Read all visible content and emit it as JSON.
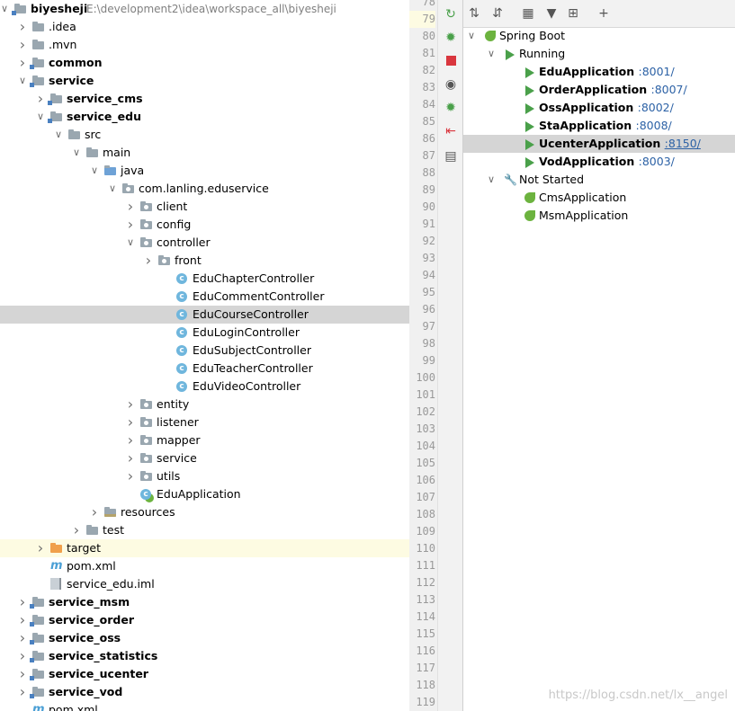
{
  "project": {
    "root_name": "biyesheji",
    "root_path": "E:\\development2\\idea\\workspace_all\\biyesheji",
    "items": [
      {
        "label": "biyesheji",
        "depth": 0,
        "arrow": "down",
        "icon": "folder-mod",
        "bold": true
      },
      {
        "label": ".idea",
        "depth": 1,
        "arrow": "right",
        "icon": "folder"
      },
      {
        "label": ".mvn",
        "depth": 1,
        "arrow": "right",
        "icon": "folder"
      },
      {
        "label": "common",
        "depth": 1,
        "arrow": "right",
        "icon": "folder-mod",
        "bold": true
      },
      {
        "label": "service",
        "depth": 1,
        "arrow": "down",
        "icon": "folder-mod",
        "bold": true
      },
      {
        "label": "service_cms",
        "depth": 2,
        "arrow": "right",
        "icon": "folder-mod",
        "bold": true
      },
      {
        "label": "service_edu",
        "depth": 2,
        "arrow": "down",
        "icon": "folder-mod",
        "bold": true
      },
      {
        "label": "src",
        "depth": 3,
        "arrow": "down",
        "icon": "folder"
      },
      {
        "label": "main",
        "depth": 4,
        "arrow": "down",
        "icon": "folder"
      },
      {
        "label": "java",
        "depth": 5,
        "arrow": "down",
        "icon": "folder-blue"
      },
      {
        "label": "com.lanling.eduservice",
        "depth": 6,
        "arrow": "down",
        "icon": "package"
      },
      {
        "label": "client",
        "depth": 7,
        "arrow": "right",
        "icon": "package"
      },
      {
        "label": "config",
        "depth": 7,
        "arrow": "right",
        "icon": "package"
      },
      {
        "label": "controller",
        "depth": 7,
        "arrow": "down",
        "icon": "package"
      },
      {
        "label": "front",
        "depth": 8,
        "arrow": "right",
        "icon": "package"
      },
      {
        "label": "EduChapterController",
        "depth": 9,
        "arrow": "",
        "icon": "class"
      },
      {
        "label": "EduCommentController",
        "depth": 9,
        "arrow": "",
        "icon": "class"
      },
      {
        "label": "EduCourseController",
        "depth": 9,
        "arrow": "",
        "icon": "class",
        "selected": true
      },
      {
        "label": "EduLoginController",
        "depth": 9,
        "arrow": "",
        "icon": "class"
      },
      {
        "label": "EduSubjectController",
        "depth": 9,
        "arrow": "",
        "icon": "class"
      },
      {
        "label": "EduTeacherController",
        "depth": 9,
        "arrow": "",
        "icon": "class"
      },
      {
        "label": "EduVideoController",
        "depth": 9,
        "arrow": "",
        "icon": "class"
      },
      {
        "label": "entity",
        "depth": 7,
        "arrow": "right",
        "icon": "package"
      },
      {
        "label": "listener",
        "depth": 7,
        "arrow": "right",
        "icon": "package"
      },
      {
        "label": "mapper",
        "depth": 7,
        "arrow": "right",
        "icon": "package"
      },
      {
        "label": "service",
        "depth": 7,
        "arrow": "right",
        "icon": "package"
      },
      {
        "label": "utils",
        "depth": 7,
        "arrow": "right",
        "icon": "package"
      },
      {
        "label": "EduApplication",
        "depth": 7,
        "arrow": "",
        "icon": "spring-class"
      },
      {
        "label": "resources",
        "depth": 5,
        "arrow": "right",
        "icon": "folder-res"
      },
      {
        "label": "test",
        "depth": 4,
        "arrow": "right",
        "icon": "folder"
      },
      {
        "label": "target",
        "depth": 2,
        "arrow": "right",
        "icon": "folder-orange",
        "highlight": true
      },
      {
        "label": "pom.xml",
        "depth": 2,
        "arrow": "",
        "icon": "maven"
      },
      {
        "label": "service_edu.iml",
        "depth": 2,
        "arrow": "",
        "icon": "file"
      },
      {
        "label": "service_msm",
        "depth": 1,
        "arrow": "right",
        "icon": "folder-mod",
        "bold": true
      },
      {
        "label": "service_order",
        "depth": 1,
        "arrow": "right",
        "icon": "folder-mod",
        "bold": true
      },
      {
        "label": "service_oss",
        "depth": 1,
        "arrow": "right",
        "icon": "folder-mod",
        "bold": true
      },
      {
        "label": "service_statistics",
        "depth": 1,
        "arrow": "right",
        "icon": "folder-mod",
        "bold": true
      },
      {
        "label": "service_ucenter",
        "depth": 1,
        "arrow": "right",
        "icon": "folder-mod",
        "bold": true
      },
      {
        "label": "service_vod",
        "depth": 1,
        "arrow": "right",
        "icon": "folder-mod",
        "bold": true
      },
      {
        "label": "pom.xml",
        "depth": 1,
        "arrow": "",
        "icon": "maven"
      }
    ]
  },
  "gutter": {
    "lines": [
      "78",
      "79",
      "80",
      "81",
      "82",
      "83",
      "84",
      "85",
      "86",
      "87",
      "88",
      "89",
      "90",
      "91",
      "92",
      "93",
      "94",
      "95",
      "96",
      "97",
      "98",
      "99",
      "100",
      "101",
      "102",
      "103",
      "104",
      "105",
      "106",
      "107",
      "108",
      "109",
      "110",
      "111",
      "112",
      "113",
      "114",
      "115",
      "116",
      "117",
      "118",
      "119"
    ],
    "current_line": "79"
  },
  "services": {
    "items": [
      {
        "label": "Spring Boot",
        "port": "",
        "depth": 0,
        "arrow": "down",
        "icon": "spring-boot-icon"
      },
      {
        "label": "Running",
        "port": "",
        "depth": 1,
        "arrow": "down",
        "icon": "run-icon"
      },
      {
        "label": "EduApplication",
        "port": ":8001/",
        "depth": 2,
        "arrow": "",
        "icon": "run-icon",
        "bold": true
      },
      {
        "label": "OrderApplication",
        "port": ":8007/",
        "depth": 2,
        "arrow": "",
        "icon": "run-icon",
        "bold": true
      },
      {
        "label": "OssApplication",
        "port": ":8002/",
        "depth": 2,
        "arrow": "",
        "icon": "run-icon",
        "bold": true
      },
      {
        "label": "StaApplication",
        "port": ":8008/",
        "depth": 2,
        "arrow": "",
        "icon": "run-icon",
        "bold": true
      },
      {
        "label": "UcenterApplication",
        "port": ":8150/",
        "depth": 2,
        "arrow": "",
        "icon": "run-icon",
        "bold": true,
        "selected": true
      },
      {
        "label": "VodApplication",
        "port": ":8003/",
        "depth": 2,
        "arrow": "",
        "icon": "run-icon",
        "bold": true
      },
      {
        "label": "Not Started",
        "port": "",
        "depth": 1,
        "arrow": "down",
        "icon": "wrench-icon"
      },
      {
        "label": "CmsApplication",
        "port": "",
        "depth": 2,
        "arrow": "",
        "icon": "spring-boot-icon"
      },
      {
        "label": "MsmApplication",
        "port": "",
        "depth": 2,
        "arrow": "",
        "icon": "spring-boot-icon"
      }
    ]
  },
  "watermark": "https://blog.csdn.net/lx__angel",
  "colors": {
    "selection": "#d5d5d5",
    "highlight": "#fdfbe2",
    "port_link": "#2d62a6",
    "run_green": "#4aa04a"
  }
}
